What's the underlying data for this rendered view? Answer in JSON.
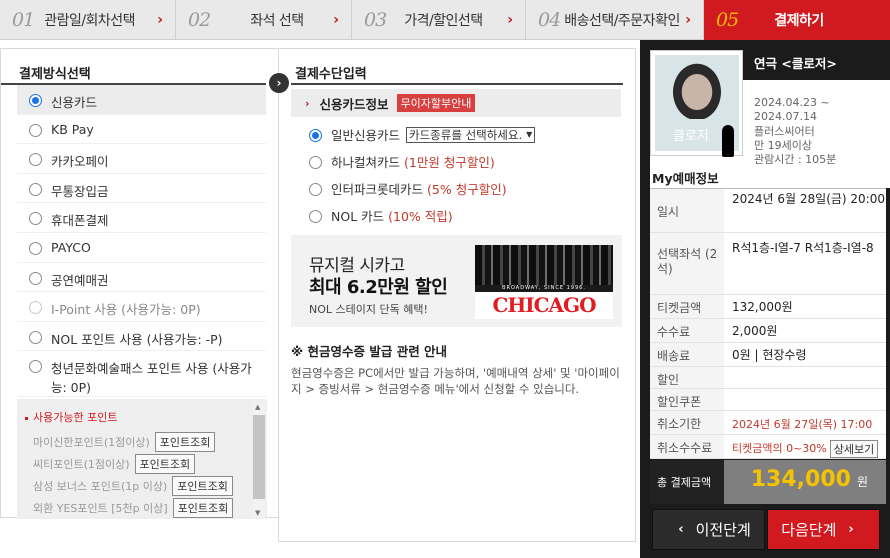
{
  "steps": [
    {
      "num": "01",
      "label": "관람일/회차선택"
    },
    {
      "num": "02",
      "label": "좌석 선택"
    },
    {
      "num": "03",
      "label": "가격/할인선택"
    },
    {
      "num": "04",
      "label": "배송선택/주문자확인"
    },
    {
      "num": "05",
      "label": "결제하기"
    }
  ],
  "active_step": 4,
  "colors": {
    "accent": "#d11a1f",
    "selected_radio": "#1a73e8",
    "price": "#f5c300"
  },
  "payment_methods": {
    "title": "결제방식선택",
    "selected_index": 0,
    "items": [
      {
        "label": "신용카드",
        "enabled": true
      },
      {
        "label": "KB Pay",
        "enabled": true
      },
      {
        "label": "카카오페이",
        "enabled": true
      },
      {
        "label": "무통장입금",
        "enabled": true
      },
      {
        "label": "휴대폰결제",
        "enabled": true
      },
      {
        "label": "PAYCO",
        "enabled": true
      },
      {
        "label": "공연예매권",
        "enabled": true
      },
      {
        "label": "I-Point 사용 (사용가능: 0P)",
        "enabled": false
      },
      {
        "label": "NOL 포인트 사용 (사용가능: -P)",
        "enabled": true
      },
      {
        "label": "청년문화예술패스 포인트 사용 (사용가능: 0P)",
        "enabled": true
      }
    ],
    "points": {
      "title": "사용가능한 포인트",
      "button": "포인트조회",
      "rows": [
        "마이신한포인트(1점이상)",
        "씨티포인트(1점이상)",
        "삼성 보너스 포인트(1p 이상)",
        "외환 YES포인트 [5천p 이상]"
      ]
    }
  },
  "payment_input": {
    "title": "결제수단입력",
    "card_header": "신용카드정보",
    "badge": "무이자할부안내",
    "selected_index": 0,
    "cards": [
      {
        "label": "일반신용카드",
        "note": ""
      },
      {
        "label": "하나컬쳐카드",
        "note": "(1만원 청구할인)"
      },
      {
        "label": "인터파크롯데카드",
        "note": "(5% 청구할인)"
      },
      {
        "label": "NOL 카드",
        "note": "(10% 적립)"
      }
    ],
    "card_select": "카드종류를 선택하세요.",
    "banner": {
      "line1": "뮤지컬 시카고",
      "line2": "최대 6.2만원 할인",
      "line3": "NOL 스테이지 단독 혜택!",
      "poster_small": "BROADWAY, SINCE 1996.",
      "poster_logo": "CHICAGO"
    },
    "receipt_title": "※ 현금영수증 발급 관련 안내",
    "receipt_body": "현금영수증은 PC에서만 발급 가능하며, '예매내역 상세' 및 '마이페이지 > 증빙서류 > 현금영수증 메뉴'에서 신청할 수 있습니다."
  },
  "show": {
    "title": "연극 <클로저>",
    "poster_text": "클로저",
    "period_start": "2024.04.23 ~",
    "period_end": "2024.07.14",
    "venue": "플러스씨어터",
    "age": "만 19세이상",
    "runtime": "관람시간 : 105분"
  },
  "reservation": {
    "title": "My예매정보",
    "rows": [
      {
        "key": "일시",
        "value": "2024년 6월 28일(금) 20:00"
      },
      {
        "key": "선택좌석 (2석)",
        "value": "R석1층-I열-7 R석1층-I열-8"
      },
      {
        "key": "티켓금액",
        "value": "132,000원"
      },
      {
        "key": "수수료",
        "value": "2,000원"
      },
      {
        "key": "배송료",
        "value": "0원 | 현장수령"
      },
      {
        "key": "할인",
        "value": ""
      },
      {
        "key": "할인쿠폰",
        "value": ""
      },
      {
        "key": "취소기한",
        "value": "2024년 6월 27일(목) 17:00"
      },
      {
        "key": "취소수수료",
        "value": "티켓금액의 0~30%"
      }
    ],
    "detail_button": "상세보기",
    "total_label": "총 결제금액",
    "total_value": "134,000",
    "total_unit": "원"
  },
  "nav": {
    "prev": "이전단계",
    "next": "다음단계"
  }
}
